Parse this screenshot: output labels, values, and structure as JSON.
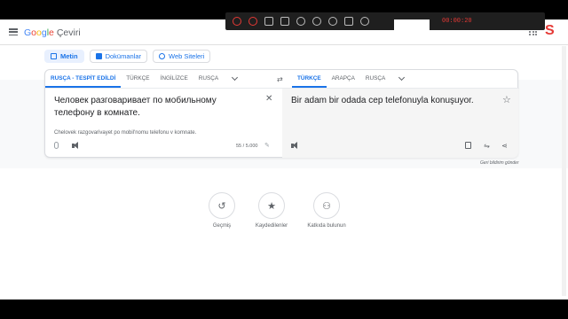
{
  "app": {
    "logo_google": "Google",
    "logo_product": "Çeviri"
  },
  "recorder": {
    "time": "00:00:20"
  },
  "modes": [
    {
      "label": "Metin",
      "icon": "text-icon",
      "active": true
    },
    {
      "label": "Dokümanlar",
      "icon": "document-icon",
      "active": false
    },
    {
      "label": "Web Siteleri",
      "icon": "globe-icon",
      "active": false
    }
  ],
  "source": {
    "languages": [
      "RUSÇA - TESPİT EDİLDİ",
      "TÜRKÇE",
      "İNGİLİZCE",
      "RUSÇA"
    ],
    "selected": 0,
    "text": "Человек разговаривает по мобильному телефону в комнате.",
    "transliteration": "Chelovek razgovarivayet po mobil'nomu telefonu v komnate.",
    "char_count": "55 / 5.000"
  },
  "target": {
    "languages": [
      "TÜRKÇE",
      "ARAPÇA",
      "RUSÇA"
    ],
    "selected": 0,
    "text": "Bir adam bir odada cep telefonuyla konuşuyor."
  },
  "feedback": "Geri bildirim gönder",
  "bottom_actions": [
    {
      "label": "Geçmiş",
      "icon": "history-icon"
    },
    {
      "label": "Kaydedilenler",
      "icon": "star-icon"
    },
    {
      "label": "Katkıda bulunun",
      "icon": "contribute-icon"
    }
  ],
  "colors": {
    "accent": "#1a73e8",
    "brand_red": "#e53935"
  }
}
